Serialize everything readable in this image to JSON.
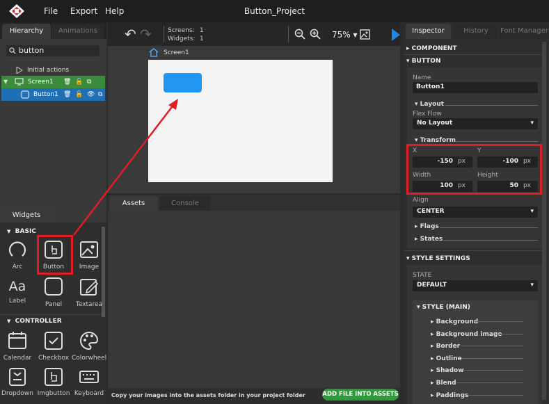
{
  "menubar": {
    "file": "File",
    "export": "Export",
    "help": "Help",
    "title": "Button_Project"
  },
  "left": {
    "tabs": [
      "Hierarchy",
      "Animations"
    ],
    "search_value": "button",
    "tree": [
      {
        "label": "Initial actions"
      },
      {
        "label": "Screen1"
      },
      {
        "label": "Button1"
      }
    ],
    "widgets_tab": "Widgets",
    "sections": {
      "basic": "BASIC",
      "controller": "CONTROLLER"
    },
    "basic_widgets": [
      "Arc",
      "Button",
      "Image",
      "Label",
      "Panel",
      "Textarea"
    ],
    "controller_widgets": [
      "Calendar",
      "Checkbox",
      "Colorwheel",
      "Dropdown",
      "Imgbutton",
      "Keyboard"
    ]
  },
  "toolbar": {
    "screens_label": "Screens:",
    "screens_count": "1",
    "widgets_label": "Widgets:",
    "widgets_count": "1",
    "zoom": "75%"
  },
  "canvas": {
    "screen_label": "Screen1",
    "button_color": "#2196f3"
  },
  "assets": {
    "tabs": [
      "Assets",
      "Console"
    ],
    "footer_text": "Copy your images into the assets folder in your project folder",
    "add_button": "ADD FILE INTO ASSETS"
  },
  "inspector": {
    "tabs": [
      "Inspector",
      "History",
      "Font Manager"
    ],
    "component": "COMPONENT",
    "button": "BUTTON",
    "name_label": "Name",
    "name_value": "Button1",
    "layout": "Layout",
    "flex_flow_label": "Flex Flow",
    "flex_flow_value": "No Layout",
    "transform": "Transform",
    "x_label": "X",
    "x_value": "-150",
    "y_label": "Y",
    "y_value": "-100",
    "width_label": "Width",
    "width_value": "100",
    "height_label": "Height",
    "height_value": "50",
    "unit": "px",
    "align_label": "Align",
    "align_value": "CENTER",
    "flags": "Flags",
    "states": "States",
    "style_settings": "STYLE SETTINGS",
    "state_label": "STATE",
    "state_value": "DEFAULT",
    "style_main": "STYLE (MAIN)",
    "style_items": [
      "Background",
      "Background image",
      "Border",
      "Outline",
      "Shadow",
      "Blend",
      "Paddings"
    ]
  },
  "colors": {
    "accent_red": "#e11d24",
    "hierarchy_green": "#3c8a3c",
    "hierarchy_blue": "#1f6fb5",
    "add_green": "#2e9b3a"
  }
}
